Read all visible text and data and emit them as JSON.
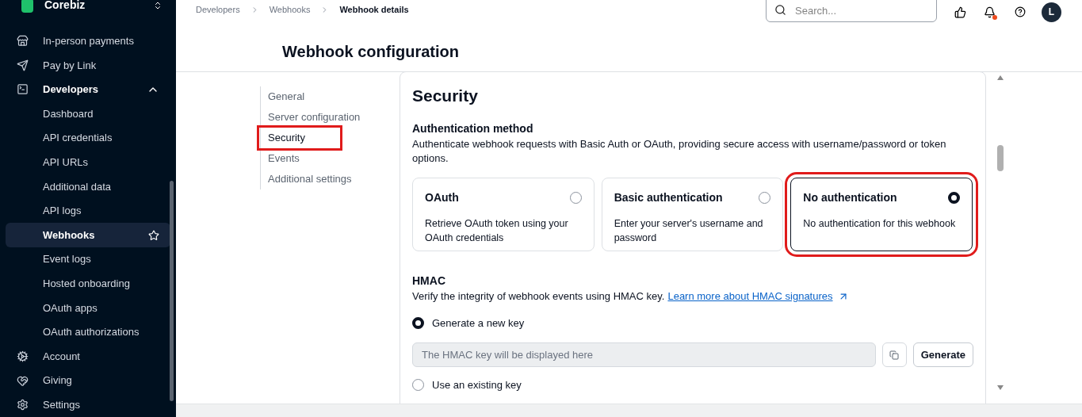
{
  "sidebar": {
    "workspace": "Corebiz",
    "items": [
      {
        "label": "In-person payments",
        "selected": false
      },
      {
        "label": "Pay by Link",
        "selected": false
      },
      {
        "label": "Developers",
        "selected": false,
        "expanded": true,
        "children": [
          {
            "label": "Dashboard",
            "selected": false
          },
          {
            "label": "API credentials",
            "selected": false
          },
          {
            "label": "API URLs",
            "selected": false
          },
          {
            "label": "Additional data",
            "selected": false
          },
          {
            "label": "API logs",
            "selected": false
          },
          {
            "label": "Webhooks",
            "selected": true
          },
          {
            "label": "Event logs",
            "selected": false
          },
          {
            "label": "Hosted onboarding",
            "selected": false
          },
          {
            "label": "OAuth apps",
            "selected": false
          },
          {
            "label": "OAuth authorizations",
            "selected": false
          }
        ]
      },
      {
        "label": "Account",
        "selected": false
      },
      {
        "label": "Giving",
        "selected": false
      },
      {
        "label": "Settings",
        "selected": false
      }
    ]
  },
  "header": {
    "breadcrumbs": [
      "Developers",
      "Webhooks",
      "Webhook details"
    ],
    "search": {
      "placeholder": "Search..."
    },
    "notification": true,
    "avatar": "L"
  },
  "page_title": "Webhook configuration",
  "section_nav": [
    {
      "label": "General",
      "selected": false,
      "highlighted": false
    },
    {
      "label": "Server configuration",
      "selected": false,
      "highlighted": false
    },
    {
      "label": "Security",
      "selected": true,
      "highlighted": true
    },
    {
      "label": "Events",
      "selected": false,
      "highlighted": false
    },
    {
      "label": "Additional settings",
      "selected": false,
      "highlighted": false
    }
  ],
  "security": {
    "title": "Security",
    "auth_heading": "Authentication method",
    "auth_description": "Authenticate webhook requests with Basic Auth or OAuth, providing secure access with username/password or token options.",
    "auth_options": [
      {
        "title": "OAuth",
        "description": "Retrieve OAuth token using your OAuth credentials",
        "selected": false,
        "highlighted": false
      },
      {
        "title": "Basic authentication",
        "description": "Enter your server's username and password",
        "selected": false,
        "highlighted": false
      },
      {
        "title": "No authentication",
        "description": "No authentication for this webhook",
        "selected": true,
        "highlighted": true
      }
    ],
    "hmac_heading": "HMAC",
    "hmac_description": "Verify the integrity of webhook events using HMAC key.",
    "hmac_link": "Learn more about HMAC signatures",
    "hmac_options": [
      {
        "label": "Generate a new key",
        "selected": true
      },
      {
        "label": "Use an existing key",
        "selected": false
      }
    ],
    "key_field": {
      "placeholder": "The HMAC key will be displayed here"
    },
    "generate_button": "Generate"
  }
}
